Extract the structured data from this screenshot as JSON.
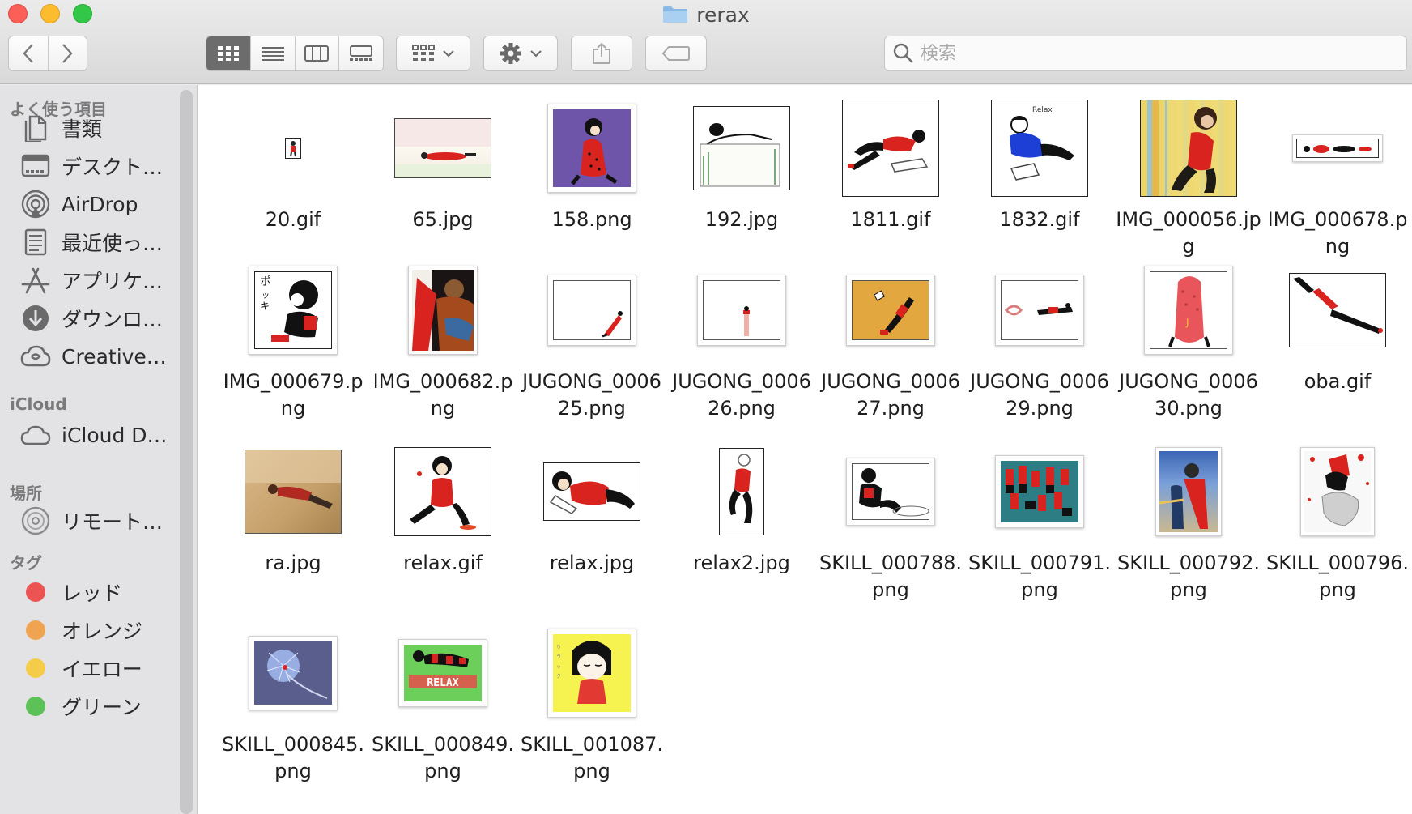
{
  "window": {
    "title": "rerax"
  },
  "toolbar": {
    "search_placeholder": "検索",
    "icons": [
      "chevron-left-icon",
      "chevron-right-icon",
      "icon-view-icon",
      "list-view-icon",
      "column-view-icon",
      "gallery-view-icon",
      "group-icon",
      "gear-icon",
      "share-icon",
      "tag-icon",
      "search-icon"
    ]
  },
  "sidebar": {
    "favorites_header": "よく使う項目",
    "favorites": [
      {
        "label": "書類",
        "icon": "documents-icon"
      },
      {
        "label": "デスクト…",
        "icon": "desktop-icon"
      },
      {
        "label": "AirDrop",
        "icon": "airdrop-icon"
      },
      {
        "label": "最近使っ…",
        "icon": "recents-icon"
      },
      {
        "label": "アプリケ…",
        "icon": "applications-icon"
      },
      {
        "label": "ダウンロ…",
        "icon": "downloads-icon"
      },
      {
        "label": "Creative…",
        "icon": "creative-cloud-icon"
      }
    ],
    "icloud_header": "iCloud",
    "icloud": [
      {
        "label": "iCloud D…",
        "icon": "cloud-icon"
      }
    ],
    "places_header": "場所",
    "places": [
      {
        "label": "リモート…",
        "icon": "disc-icon"
      }
    ],
    "tags_header": "タグ",
    "tags": [
      {
        "label": "レッド",
        "color": "#ec5353"
      },
      {
        "label": "オレンジ",
        "color": "#f0a350"
      },
      {
        "label": "イエロー",
        "color": "#f4cc4a"
      },
      {
        "label": "グリーン",
        "color": "#5cc157"
      }
    ]
  },
  "files": [
    {
      "name": "20.gif"
    },
    {
      "name": "65.jpg"
    },
    {
      "name": "158.png"
    },
    {
      "name": "192.jpg"
    },
    {
      "name": "1811.gif"
    },
    {
      "name": "1832.gif"
    },
    {
      "name": "IMG_000056.jpg"
    },
    {
      "name": "IMG_000678.png"
    },
    {
      "name": "IMG_000679.png"
    },
    {
      "name": "IMG_000682.png"
    },
    {
      "name": "JUGONG_000625.png"
    },
    {
      "name": "JUGONG_000626.png"
    },
    {
      "name": "JUGONG_000627.png"
    },
    {
      "name": "JUGONG_000629.png"
    },
    {
      "name": "JUGONG_000630.png"
    },
    {
      "name": "oba.gif"
    },
    {
      "name": "ra.jpg"
    },
    {
      "name": "relax.gif"
    },
    {
      "name": "relax.jpg"
    },
    {
      "name": "relax2.jpg"
    },
    {
      "name": "SKILL_000788.png"
    },
    {
      "name": "SKILL_000791.png"
    },
    {
      "name": "SKILL_000792.png"
    },
    {
      "name": "SKILL_000796.png"
    },
    {
      "name": "SKILL_000845.png"
    },
    {
      "name": "SKILL_000849.png"
    },
    {
      "name": "SKILL_001087.png"
    }
  ],
  "thumb_text": {
    "relax_banner": "RELAX"
  },
  "colors": {
    "accent_red": "#d8231f",
    "selected_view": "#6c6c6c",
    "sidebar_bg": "#e3e3e6"
  }
}
